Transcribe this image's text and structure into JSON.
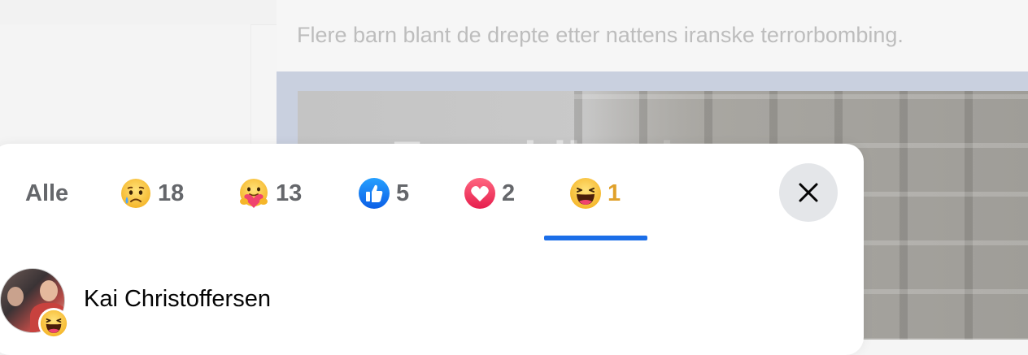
{
  "background": {
    "post_text": "Flere barn blant de drepte etter nattens iranske terrorbombing.",
    "image_headline": "En voldig trist og"
  },
  "modal": {
    "tabs": [
      {
        "label": "Alle",
        "icon": null,
        "count": null
      },
      {
        "label": "",
        "icon": "sad-cry-icon",
        "count": "18"
      },
      {
        "label": "",
        "icon": "care-hug-icon",
        "count": "13"
      },
      {
        "label": "",
        "icon": "like-thumb-icon",
        "count": "5"
      },
      {
        "label": "",
        "icon": "love-heart-icon",
        "count": "2"
      },
      {
        "label": "",
        "icon": "haha-laugh-icon",
        "count": "1",
        "active": true
      }
    ],
    "close_icon": "close-icon",
    "accent_color": "#1b6ee8",
    "active_count_color": "#e0a12b"
  },
  "reactors": [
    {
      "name": "Kai Christoffersen",
      "reaction_icon": "haha-laugh-icon"
    }
  ]
}
